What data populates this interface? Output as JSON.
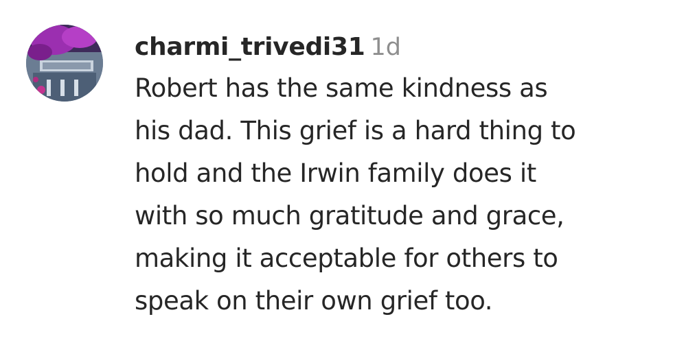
{
  "comment": {
    "avatar_icon": "user-avatar-photo",
    "username": "charmi_trivedi31",
    "timestamp": "1d",
    "text_lines": [
      "Robert has the same kindness as",
      "his dad. This grief is a hard thing to",
      "hold and the Irwin family does it",
      "with so much gratitude and grace,",
      "making it acceptable for others to",
      "speak on their own grief too."
    ]
  },
  "colors": {
    "username": "#262626",
    "timestamp": "#8e8e8e",
    "text": "#262626",
    "background": "#ffffff"
  }
}
